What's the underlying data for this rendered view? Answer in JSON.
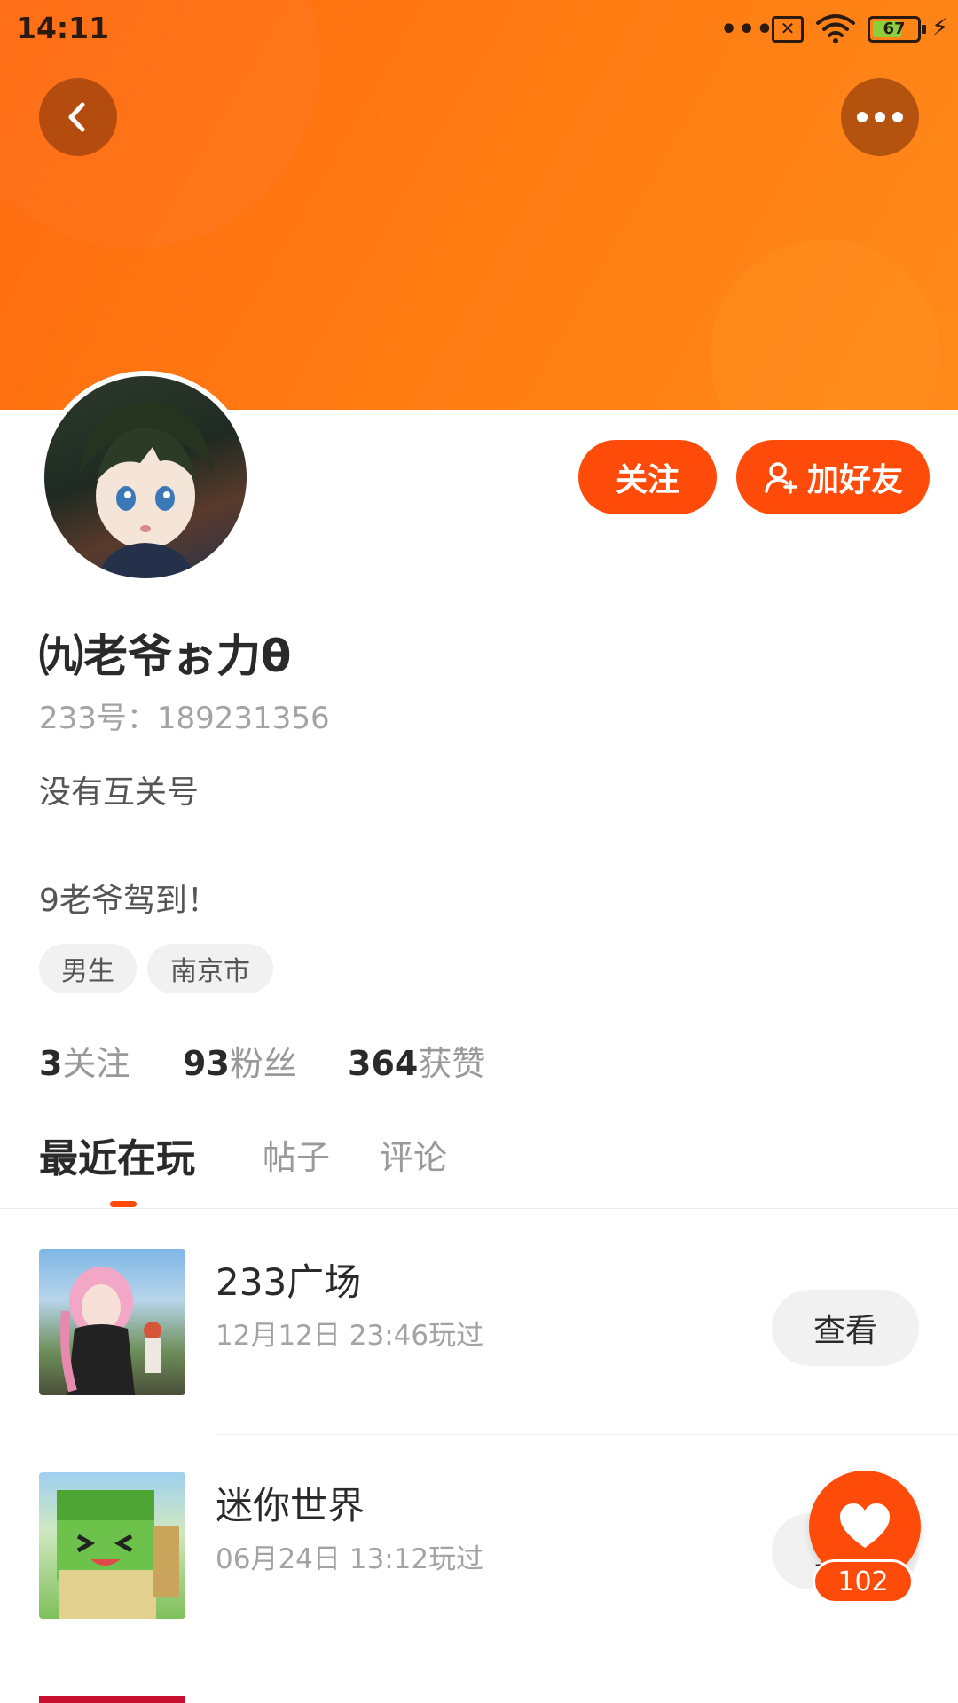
{
  "status_bar": {
    "time": "14:11",
    "dots": "•••",
    "sim_icon": "sim-x-icon",
    "battery": "67",
    "battery_level": 0.67,
    "charging_icon": "⚡"
  },
  "header": {
    "back_icon": "chevron-left-icon",
    "more_icon": "more-dots-icon"
  },
  "profile": {
    "name": "㈨老爷ぉ力θ",
    "uid": "233号：189231356",
    "bio_line1": "没有互关号",
    "bio_line2": "9老爷驾到！",
    "tags": [
      "男生",
      "南京市"
    ]
  },
  "actions": {
    "follow": "关注",
    "add_friend": "加好友"
  },
  "stats": {
    "following_count": "3",
    "following_label": "关注",
    "fans_count": "93",
    "fans_label": "粉丝",
    "likes_count": "364",
    "likes_label": "获赞"
  },
  "tabs": [
    {
      "label": "最近在玩",
      "active": true
    },
    {
      "label": "帖子",
      "active": false
    },
    {
      "label": "评论",
      "active": false
    }
  ],
  "games": [
    {
      "title": "233广场",
      "played": "12月12日 23:46玩过",
      "button": "查看"
    },
    {
      "title": "迷你世界",
      "played": "06月24日 13:12玩过",
      "button": "查看"
    }
  ],
  "fab": {
    "icon": "heart-icon",
    "count": "102"
  },
  "colors": {
    "accent": "#ff4b0a",
    "header_start": "#ff6a0f",
    "header_end": "#ff8a1a"
  }
}
